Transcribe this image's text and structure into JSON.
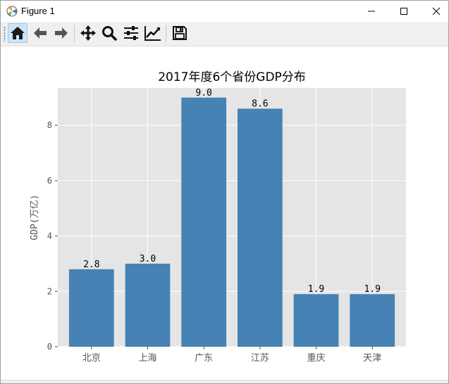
{
  "window": {
    "title": "Figure 1",
    "controls": [
      "minimize",
      "maximize",
      "close"
    ]
  },
  "toolbar": {
    "buttons": [
      {
        "id": "home",
        "icon": "home-icon"
      },
      {
        "id": "back",
        "icon": "arrow-left-icon"
      },
      {
        "id": "forward",
        "icon": "arrow-right-icon"
      },
      {
        "id": "pan",
        "icon": "move-icon"
      },
      {
        "id": "zoom",
        "icon": "magnifier-icon"
      },
      {
        "id": "configure",
        "icon": "sliders-icon"
      },
      {
        "id": "edit",
        "icon": "line-chart-icon"
      },
      {
        "id": "save",
        "icon": "floppy-disk-icon"
      }
    ]
  },
  "colors": {
    "bar": "#4682b4",
    "axes_bg": "#e5e5e5",
    "grid": "#ffffff"
  },
  "chart_data": {
    "type": "bar",
    "title": "2017年度6个省份GDP分布",
    "xlabel": "",
    "ylabel": "GDP(万亿)",
    "categories": [
      "北京",
      "上海",
      "广东",
      "江苏",
      "重庆",
      "天津"
    ],
    "values": [
      2.8,
      3.0,
      9.0,
      8.6,
      1.9,
      1.9
    ],
    "value_labels": [
      "2.8",
      "3.0",
      "9.0",
      "8.6",
      "1.9",
      "1.9"
    ],
    "ylim": [
      0,
      9.35
    ],
    "yticks": [
      0,
      2,
      4,
      6,
      8
    ],
    "grid": true,
    "style": "ggplot"
  }
}
